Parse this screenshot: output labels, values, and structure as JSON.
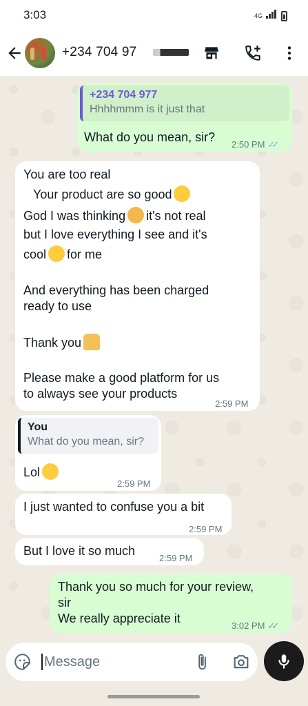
{
  "status": {
    "time": "3:03",
    "network": "4G"
  },
  "header": {
    "contact": "+234 704 97",
    "icons": [
      "back-arrow-icon",
      "shop-icon",
      "add-call-icon",
      "more-vert-icon"
    ]
  },
  "messages": [
    {
      "dir": "out",
      "quote_name": "+234 704 977",
      "quote_text": "Hhhhmmm is it just that",
      "lines": [
        "What do you mean, sir?"
      ],
      "time": "2:50 PM",
      "status": "read"
    },
    {
      "dir": "in",
      "lines": [
        "You are too real",
        "Your product are so good",
        "God I was thinking",
        "it's not real",
        "but I love everything I see and it's",
        "cool",
        "for me",
        "",
        "And everything has been charged",
        "ready to use",
        "",
        "Thank you",
        "",
        "Please make a good platform for us",
        "to always see your products"
      ],
      "time": "2:59 PM"
    },
    {
      "dir": "in",
      "quote_name": "You",
      "quote_text": "What do you mean, sir?",
      "lines": [
        "Lol"
      ],
      "time": "2:59 PM"
    },
    {
      "dir": "in",
      "lines": [
        "I just wanted to confuse you a bit"
      ],
      "time": "2:59 PM"
    },
    {
      "dir": "in",
      "lines": [
        "But I love it so much"
      ],
      "time": "2:59 PM"
    },
    {
      "dir": "out",
      "lines": [
        "Thank you so much for your review,",
        "sir",
        "We really appreciate it"
      ],
      "time": "3:02 PM",
      "status": "delivered"
    }
  ],
  "composer": {
    "placeholder": "Message"
  },
  "colors": {
    "incoming": "#ffffff",
    "outgoing": "#d9fdd3",
    "read_ticks": "#53bdeb",
    "background": "#efeae2"
  }
}
